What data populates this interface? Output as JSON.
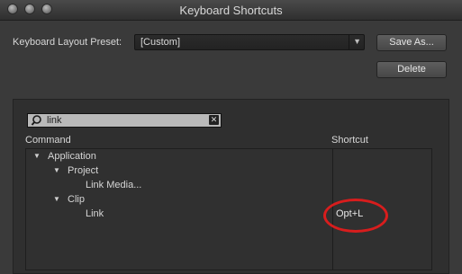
{
  "window": {
    "title": "Keyboard Shortcuts"
  },
  "preset": {
    "label": "Keyboard Layout Preset:",
    "value": "[Custom]"
  },
  "buttons": {
    "save_as": "Save As...",
    "delete": "Delete"
  },
  "search": {
    "value": "link"
  },
  "columns": {
    "command": "Command",
    "shortcut": "Shortcut"
  },
  "tree": [
    {
      "label": "Application",
      "expanded": true,
      "shortcut": ""
    },
    {
      "label": "Project",
      "expanded": true,
      "shortcut": ""
    },
    {
      "label": "Link Media...",
      "shortcut": ""
    },
    {
      "label": "Clip",
      "expanded": true,
      "shortcut": ""
    },
    {
      "label": "Link",
      "shortcut": "Opt+L"
    }
  ],
  "colors": {
    "annotation": "#d81d1d"
  }
}
